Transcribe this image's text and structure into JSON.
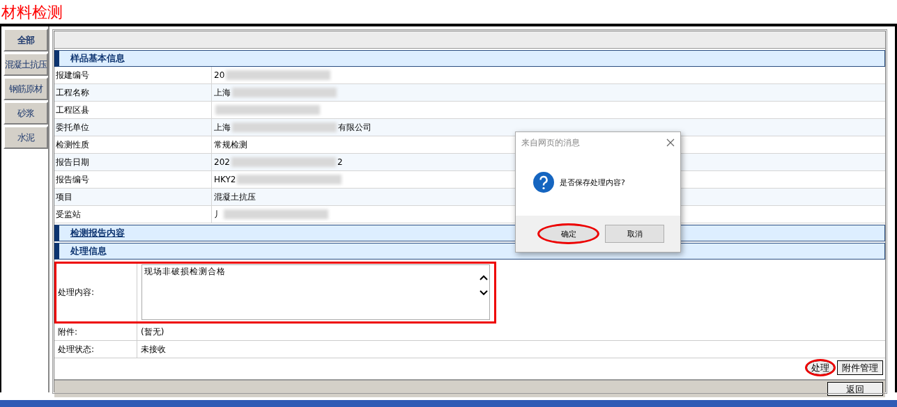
{
  "page_title": "材料检测",
  "sidebar": {
    "items": [
      {
        "label": "全部",
        "selected": true
      },
      {
        "label": "混凝土抗压",
        "selected": false
      },
      {
        "label": "钢筋原材",
        "selected": false
      },
      {
        "label": "砂浆",
        "selected": false
      },
      {
        "label": "水泥",
        "selected": false
      }
    ]
  },
  "sections": [
    {
      "title": "样品基本信息",
      "link": false,
      "rows": [
        {
          "label": "报建编号",
          "value": "20",
          "redacted": true
        },
        {
          "label": "工程名称",
          "value": "上海",
          "redacted": true
        },
        {
          "label": "工程区县",
          "value": "",
          "redacted": true
        },
        {
          "label": "委托单位",
          "value": "上海",
          "redacted": true,
          "value_end": "有限公司"
        },
        {
          "label": "检测性质",
          "value": "常规检测",
          "redacted": false
        },
        {
          "label": "报告日期",
          "value": "202",
          "redacted": true,
          "value_end": "2"
        },
        {
          "label": "报告编号",
          "value": "HKY2",
          "redacted": true
        },
        {
          "label": "项目",
          "value": "混凝土抗压",
          "redacted": false
        },
        {
          "label": "受监站",
          "value": "丿",
          "redacted": true
        }
      ]
    },
    {
      "title": "检测报告内容",
      "link": true
    },
    {
      "title": "处理信息",
      "link": false
    }
  ],
  "process": {
    "content_label": "处理内容:",
    "content_value": "现场非破损检测合格",
    "highlighted": true,
    "rows": [
      {
        "label": "附件:",
        "value": "(暂无)"
      },
      {
        "label": "处理状态:",
        "value": "未接收"
      }
    ]
  },
  "actions": [
    {
      "label": "处理",
      "circled": true
    },
    {
      "label": "附件管理",
      "circled": false
    }
  ],
  "footer": {
    "back_button": "返回"
  },
  "dialog": {
    "title": "来自网页的消息",
    "message": "是否保存处理内容?",
    "buttons": [
      {
        "label": "确定",
        "circled": true
      },
      {
        "label": "取消",
        "circled": false
      }
    ]
  }
}
